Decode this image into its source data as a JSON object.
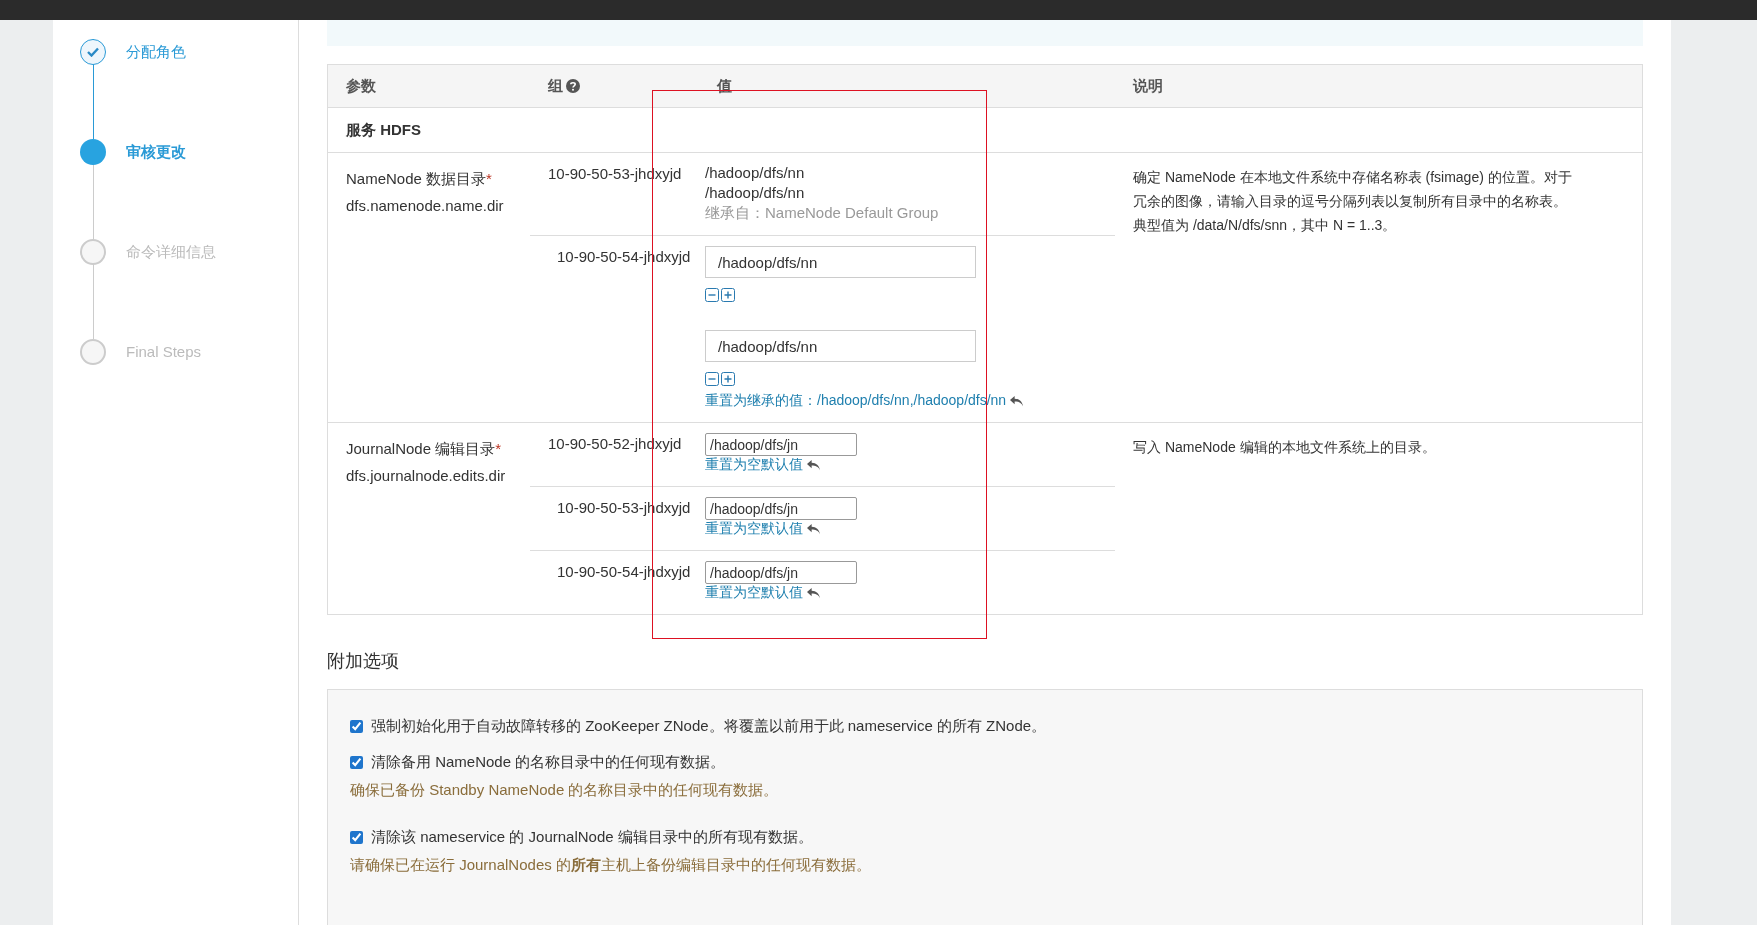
{
  "steps": [
    {
      "label": "分配角色",
      "completed": true,
      "selected": false
    },
    {
      "label": "审核更改",
      "completed": false,
      "selected": true
    },
    {
      "label": "命令详细信息",
      "completed": false,
      "selected": false
    },
    {
      "label": "Final Steps",
      "completed": false,
      "selected": false
    }
  ],
  "table": {
    "columns": [
      {
        "label": "参数",
        "help": false
      },
      {
        "label": "组",
        "help": true
      },
      {
        "label": "值",
        "help": false
      },
      {
        "label": "说明",
        "help": false
      }
    ],
    "section": "服务 HDFS",
    "properties": [
      {
        "label": "NameNode 数据目录",
        "required_mark": "*",
        "key": "dfs.namenode.name.dir",
        "description": "确定 NameNode 在本地文件系统中存储名称表 (fsimage) 的位置。对于冗余的图像，请输入目录的逗号分隔列表以复制所有目录中的名称表。典型值为 /data/N/dfs/snn，其中 N = 1..3。",
        "hosts": [
          {
            "host": "10-90-50-53-jhdxyjd",
            "kind": "inherited",
            "values": [
              "/hadoop/dfs/nn",
              "/hadoop/dfs/nn"
            ],
            "note": "继承自：NameNode Default Group"
          },
          {
            "host": "10-90-50-54-jhdxyjd",
            "kind": "multi",
            "values": [
              "/hadoop/dfs/nn",
              "/hadoop/dfs/nn"
            ],
            "reset_link": "重置为继承的值：/hadoop/dfs/nn,/hadoop/dfs/nn"
          }
        ]
      },
      {
        "label": "JournalNode 编辑目录",
        "required_mark": "*",
        "key": "dfs.journalnode.edits.dir",
        "description": "写入 NameNode 编辑的本地文件系统上的目录。",
        "hosts": [
          {
            "host": "10-90-50-52-jhdxyjd",
            "kind": "single",
            "values": [
              "/hadoop/dfs/jn"
            ],
            "reset_link": "重置为空默认值"
          },
          {
            "host": "10-90-50-53-jhdxyjd",
            "kind": "single",
            "values": [
              "/hadoop/dfs/jn"
            ],
            "reset_link": "重置为空默认值"
          },
          {
            "host": "10-90-50-54-jhdxyjd",
            "kind": "single",
            "values": [
              "/hadoop/dfs/jn"
            ],
            "reset_link": "重置为空默认值"
          }
        ]
      }
    ]
  },
  "options": {
    "title": "附加选项",
    "items": [
      {
        "label": "强制初始化用于自动故障转移的 ZooKeeper ZNode。将覆盖以前用于此 nameservice 的所有 ZNode。",
        "checked": true
      },
      {
        "label": "清除备用 NameNode 的名称目录中的任何现有数据。",
        "checked": true,
        "warning": "确保已备份 Standby NameNode 的名称目录中的任何现有数据。"
      },
      {
        "label": "清除该 nameservice 的 JournalNode 编辑目录中的所有现有数据。",
        "checked": true,
        "warning": "请确保已在运行 JournalNodes 的**所有**主机上备份编辑目录中的任何现有数据。"
      }
    ]
  }
}
